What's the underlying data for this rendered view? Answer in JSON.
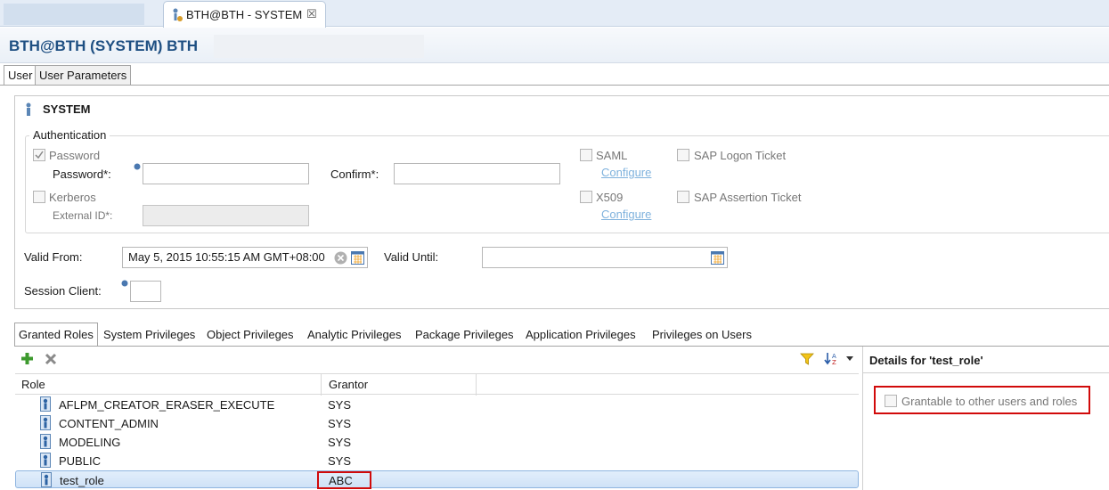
{
  "editor_tab": {
    "label": "BTH@BTH - SYSTEM",
    "close_icon": "close-x"
  },
  "header": {
    "title": "BTH@BTH (SYSTEM) BTH"
  },
  "subtabs": [
    "User",
    "User Parameters"
  ],
  "user": {
    "name": "SYSTEM"
  },
  "authentication": {
    "legend": "Authentication",
    "password_checkbox": "Password",
    "password_label": "Password*:",
    "confirm_label": "Confirm*:",
    "kerberos_checkbox": "Kerberos",
    "external_id_label": "External ID*:",
    "saml_checkbox": "SAML",
    "saml_configure": "Configure",
    "x509_checkbox": "X509",
    "x509_configure": "Configure",
    "sap_logon_ticket": "SAP Logon Ticket",
    "sap_assertion_ticket": "SAP Assertion Ticket"
  },
  "validity": {
    "valid_from_label": "Valid From:",
    "valid_from_value": "May 5, 2015 10:55:15 AM GMT+08:00",
    "valid_until_label": "Valid Until:",
    "valid_until_value": ""
  },
  "session_client": {
    "label": "Session Client:",
    "value": ""
  },
  "bottom_tabs": [
    "Granted Roles",
    "System Privileges",
    "Object Privileges",
    "Analytic Privileges",
    "Package Privileges",
    "Application Privileges",
    "Privileges on Users"
  ],
  "roles_table": {
    "columns": [
      "Role",
      "Grantor"
    ],
    "rows": [
      {
        "role": "AFLPM_CREATOR_ERASER_EXECUTE",
        "grantor": "SYS"
      },
      {
        "role": "CONTENT_ADMIN",
        "grantor": "SYS"
      },
      {
        "role": "MODELING",
        "grantor": "SYS"
      },
      {
        "role": "PUBLIC",
        "grantor": "SYS"
      },
      {
        "role": "test_role",
        "grantor": "ABC"
      }
    ]
  },
  "details": {
    "title": "Details for 'test_role'",
    "grantable_label": "Grantable to other users and roles"
  },
  "colors": {
    "header_title": "#1e4f82",
    "highlight_box": "#d10a0a",
    "selected_row": "#cfe2f7"
  }
}
